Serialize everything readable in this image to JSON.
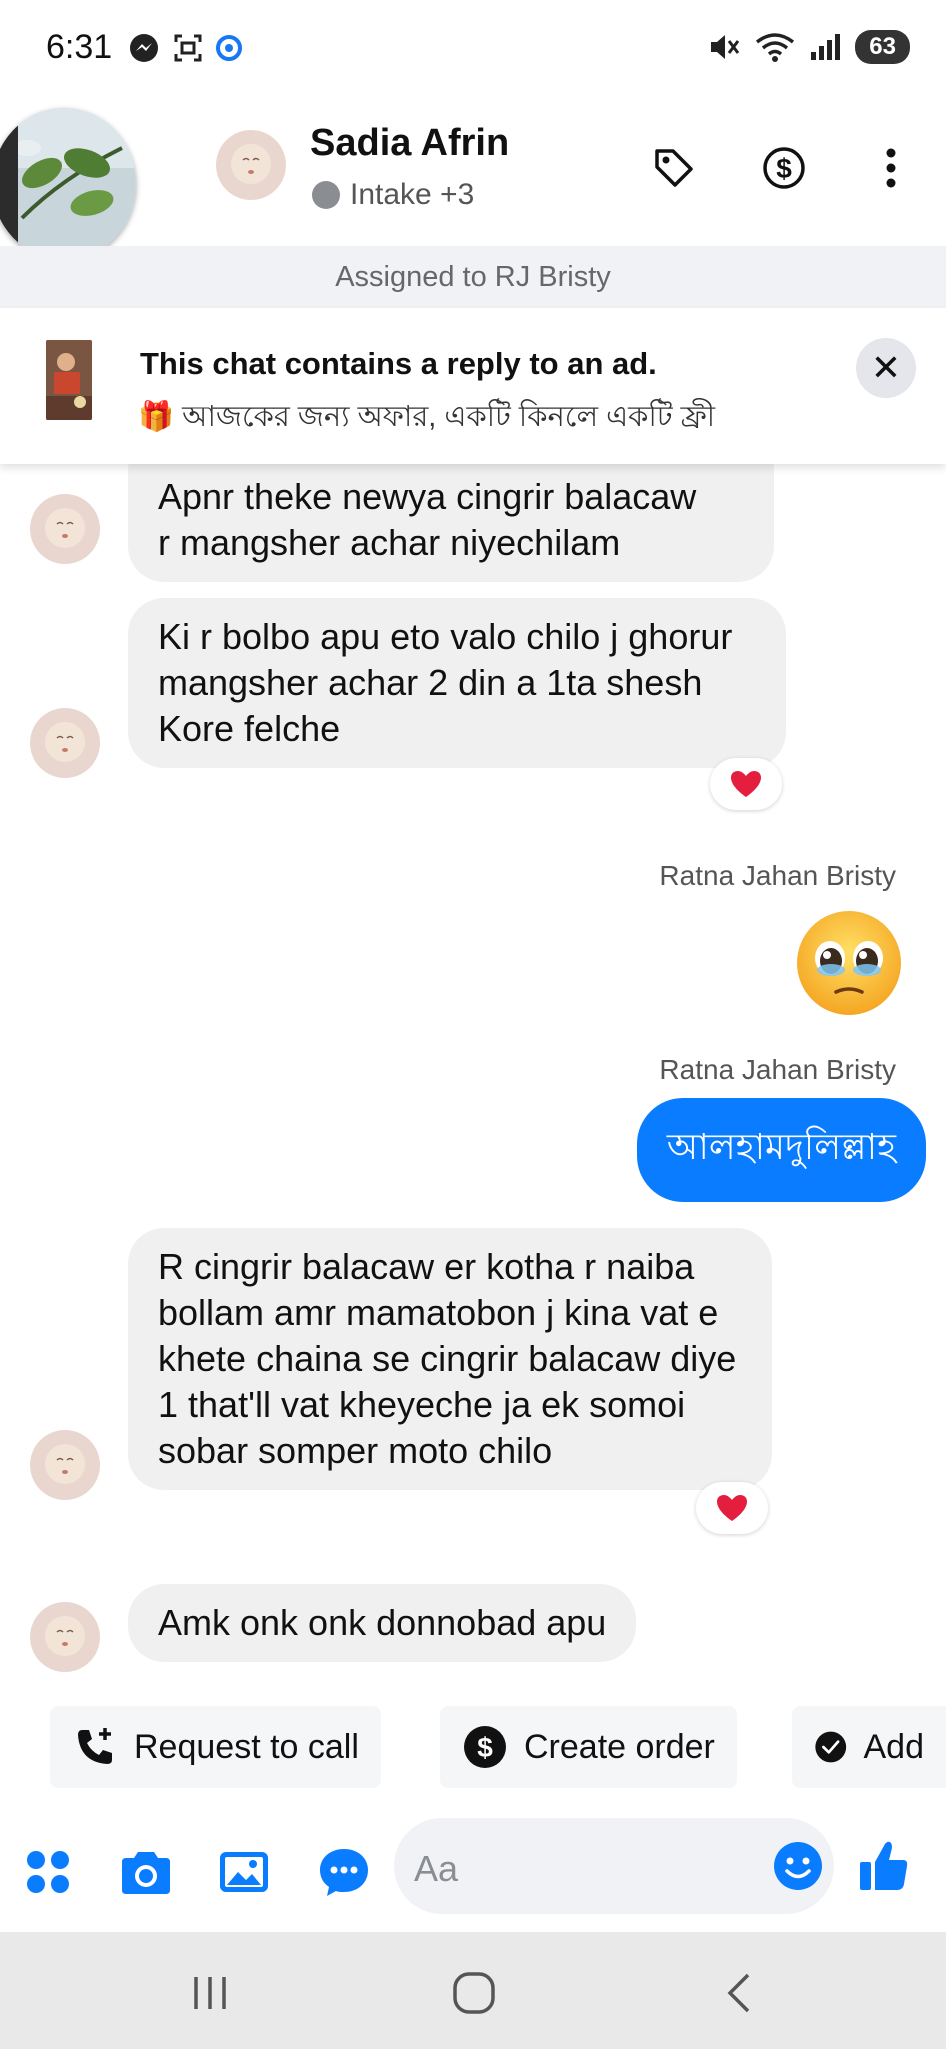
{
  "status": {
    "time": "6:31",
    "battery": "63",
    "signal_label": "5"
  },
  "header": {
    "name": "Sadia Afrin",
    "subtitle": "Intake +3",
    "assigned": "Assigned to RJ Bristy"
  },
  "ad_banner": {
    "title": "This chat contains a reply to an ad.",
    "offer": "🎁 আজকের জন্য অফার, একটি কিনলে একটি ফ্রী"
  },
  "messages": {
    "m1_line1": "Apnr theke newya cingrir balacaw",
    "m1_line2": "r mangsher achar niyechilam",
    "m2": "Ki r bolbo apu eto valo chilo j ghorur mangsher achar 2 din a 1ta shesh Kore felche",
    "sender1": "Ratna Jahan Bristy",
    "sender2": "Ratna Jahan Bristy",
    "out_text": "আলহামদুলিল্লাহ",
    "m3": "R cingrir balacaw er kotha r naiba bollam amr mamatobon j kina vat e khete chaina se cingrir balacaw diye 1 that'll vat kheyeche ja ek somoi sobar somper moto chilo",
    "m4": "Amk onk onk donnobad apu"
  },
  "quick_actions": [
    {
      "label": "Request to call",
      "icon": "phone-plus-icon"
    },
    {
      "label": "Create order",
      "icon": "dollar-circle-icon"
    },
    {
      "label": "Add",
      "icon": "check-circle-icon"
    }
  ],
  "composer": {
    "placeholder": "Aa"
  },
  "colors": {
    "accent": "#0a7cff",
    "bubble_in": "#f0f0f0",
    "heart": "#e41e3f"
  }
}
